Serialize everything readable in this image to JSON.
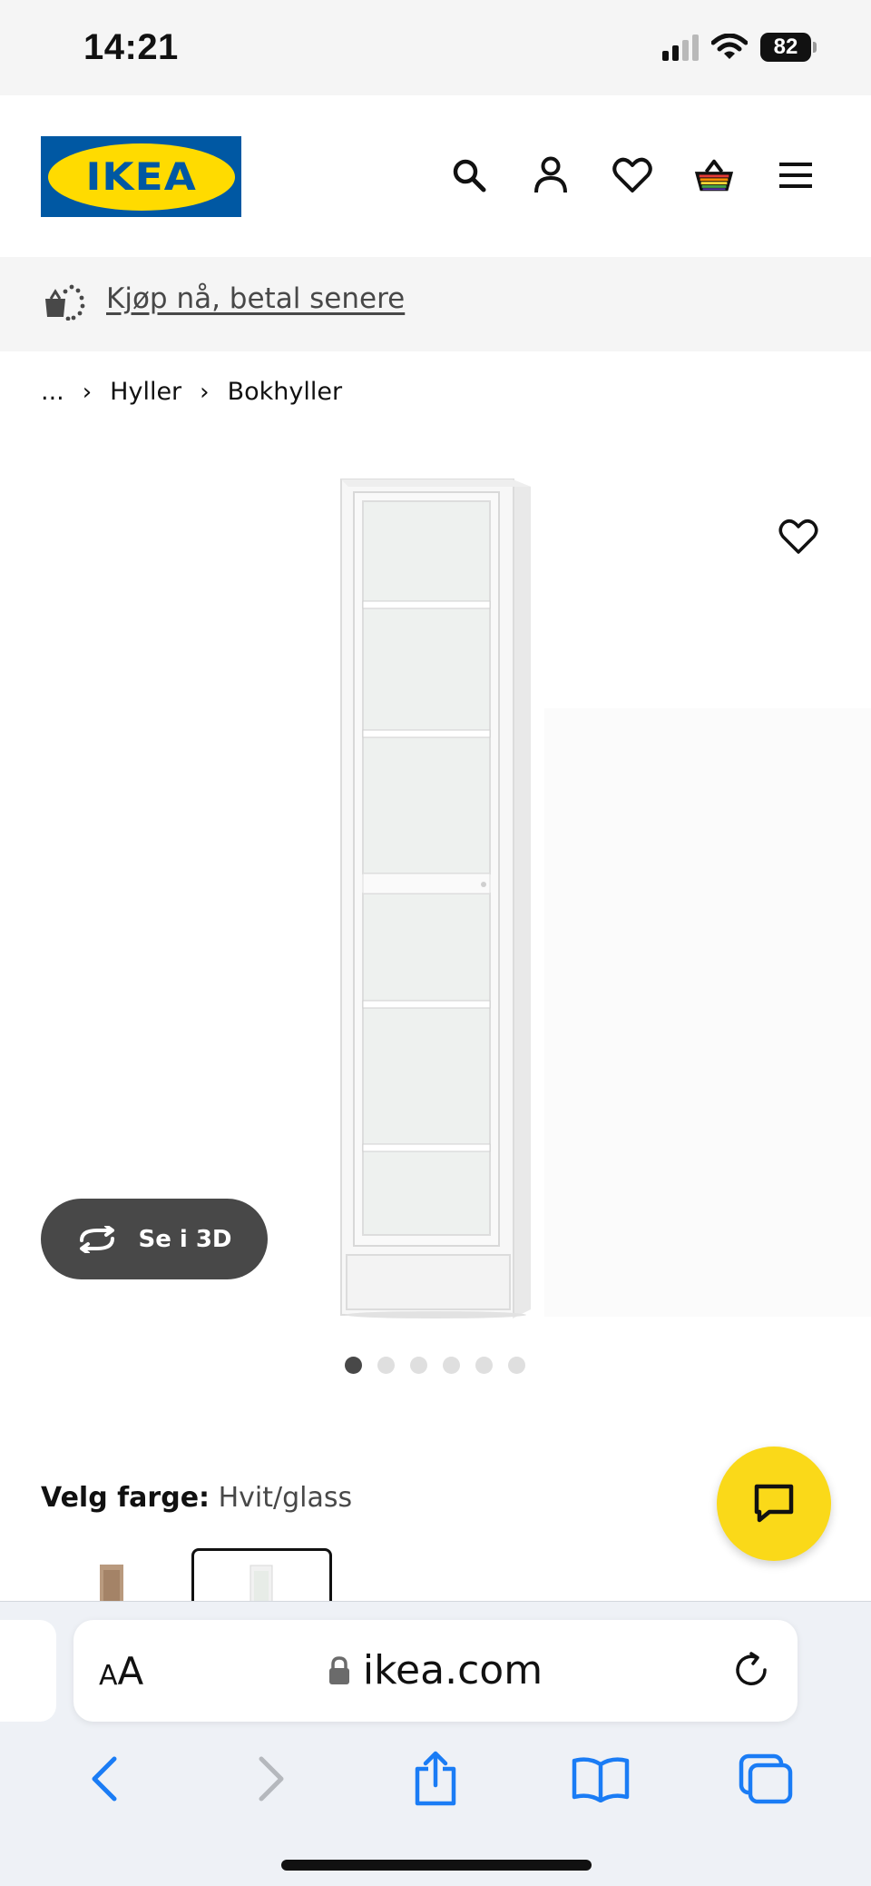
{
  "status_bar": {
    "time": "14:21",
    "battery": "82"
  },
  "header": {
    "logo_text": "IKEA"
  },
  "paylater": {
    "link_text": "Kjøp nå, betal senere"
  },
  "breadcrumb": {
    "ellipsis": "...",
    "items": [
      "Hyller",
      "Bokhyller"
    ]
  },
  "product": {
    "view_3d_label": "Se i 3D",
    "image_count": 6,
    "active_image": 1
  },
  "color": {
    "label": "Velg farge:",
    "value": "Hvit/glass"
  },
  "browser": {
    "text_size_large": "A",
    "text_size_small": "A",
    "url": "ikea.com"
  },
  "colors": {
    "ikea_blue": "#0058a3",
    "ikea_yellow": "#ffdb00",
    "chat_yellow": "#fad919",
    "safari_blue": "#1a7cf5"
  }
}
